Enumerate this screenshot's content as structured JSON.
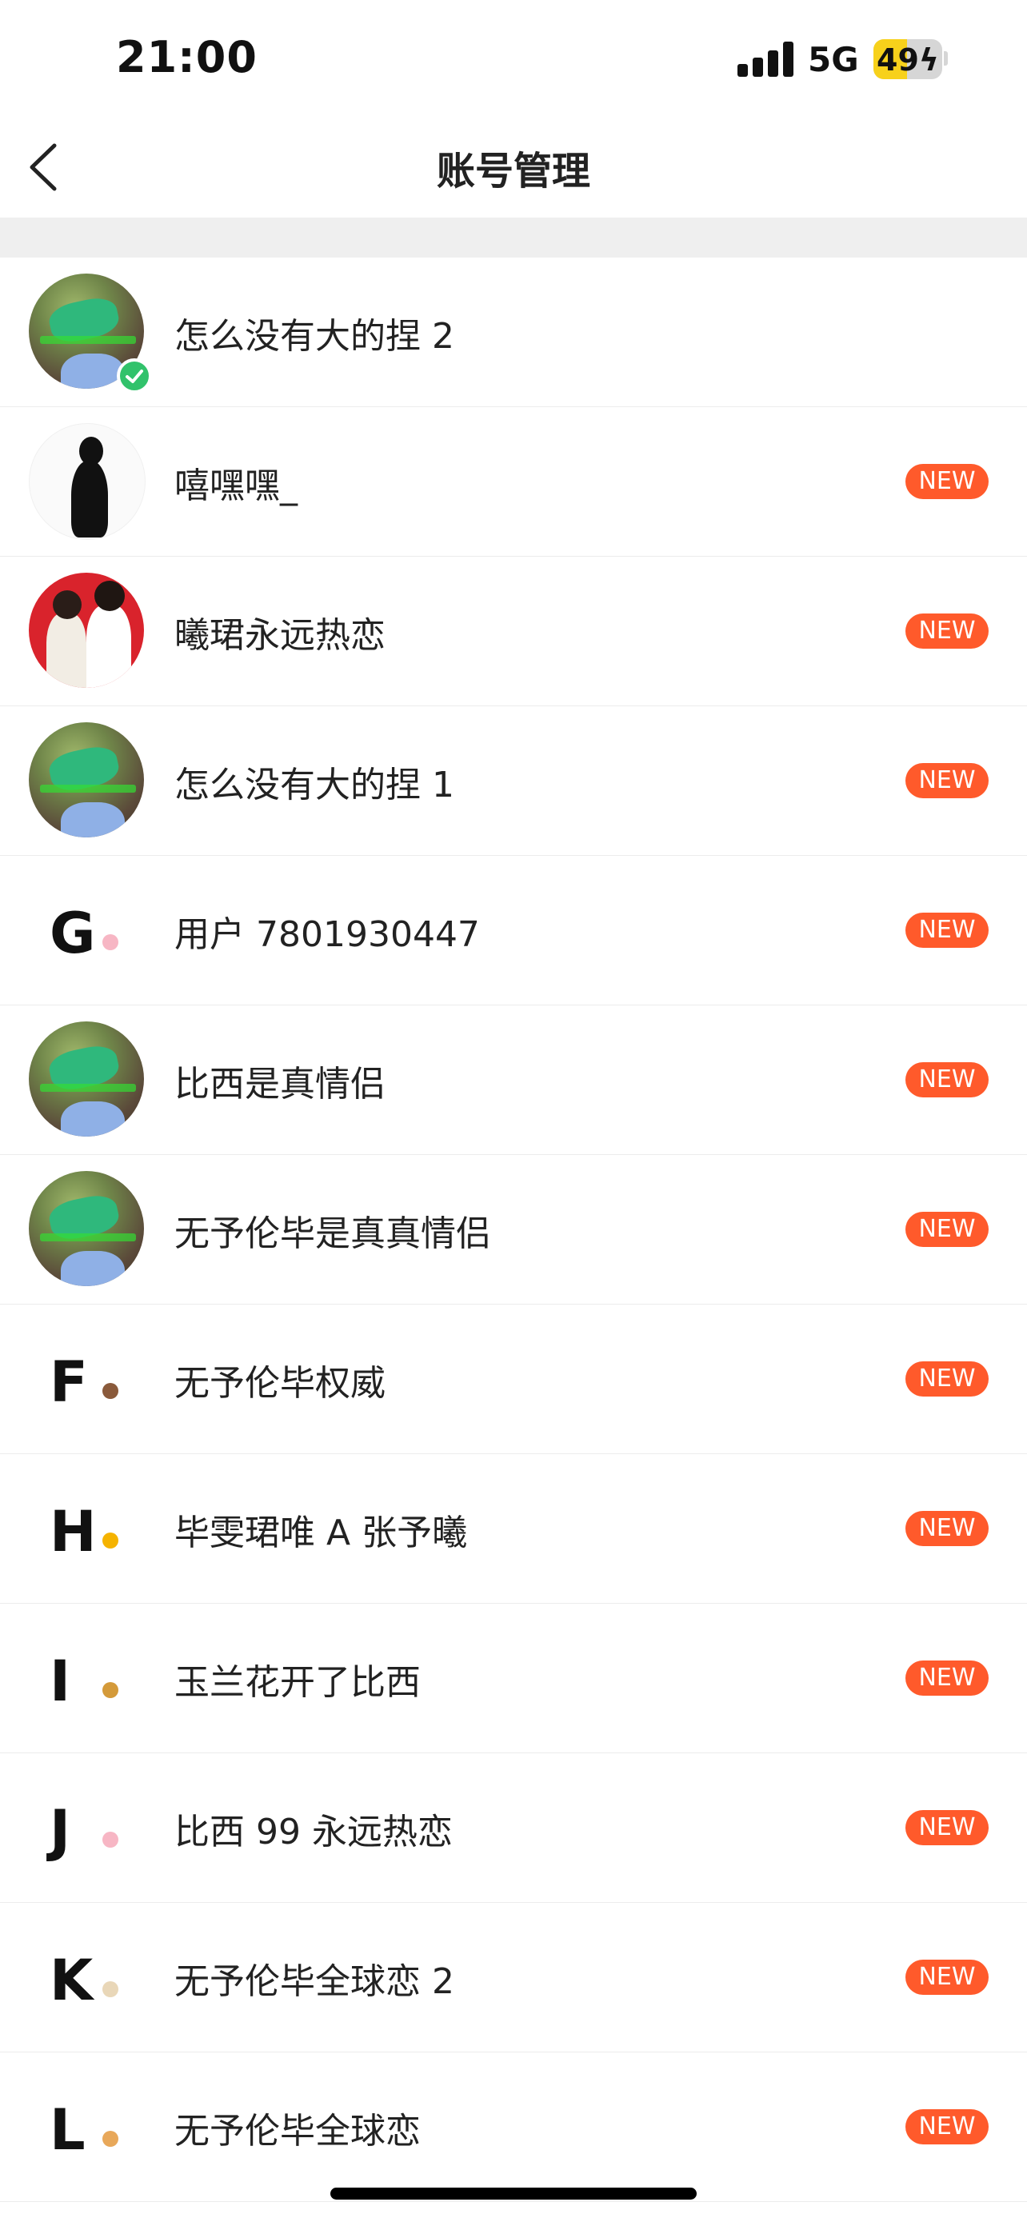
{
  "status_bar": {
    "time": "21:00",
    "network": "5G",
    "battery_percent": 49,
    "battery_label": "49",
    "signal_bars": 4
  },
  "header": {
    "title": "账号管理"
  },
  "colors": {
    "new_badge": "#ff5a2b",
    "current_check": "#31c26b",
    "separator_band": "#efefef"
  },
  "accounts": [
    {
      "name": "怎么没有大的捏 2",
      "avatar": "photo-avatar",
      "current": true
    },
    {
      "name": "嘻嘿嘿_",
      "avatar": "silhouette-avatar",
      "badge": "NEW"
    },
    {
      "name": "曦珺永远热恋",
      "avatar": "couple-photo-avatar",
      "badge": "NEW"
    },
    {
      "name": "怎么没有大的捏 1",
      "avatar": "photo-avatar",
      "badge": "NEW"
    },
    {
      "name": "用户 7801930447",
      "avatar": "letter-avatar",
      "letter": "G",
      "badge": "NEW"
    },
    {
      "name": "比西是真情侣",
      "avatar": "photo-avatar",
      "badge": "NEW"
    },
    {
      "name": "无予伦毕是真真情侣",
      "avatar": "photo-avatar",
      "badge": "NEW"
    },
    {
      "name": "无予伦毕权威",
      "avatar": "letter-avatar",
      "letter": "F",
      "badge": "NEW"
    },
    {
      "name": "毕雯珺唯 A 张予曦",
      "avatar": "letter-avatar",
      "letter": "H",
      "badge": "NEW"
    },
    {
      "name": "玉兰花开了比西",
      "avatar": "letter-avatar",
      "letter": "I",
      "badge": "NEW"
    },
    {
      "name": "比西 99 永远热恋",
      "avatar": "letter-avatar",
      "letter": "J",
      "badge": "NEW"
    },
    {
      "name": "无予伦毕全球恋 2",
      "avatar": "letter-avatar",
      "letter": "K",
      "badge": "NEW"
    },
    {
      "name": "无予伦毕全球恋",
      "avatar": "letter-avatar",
      "letter": "L",
      "badge": "NEW"
    }
  ]
}
